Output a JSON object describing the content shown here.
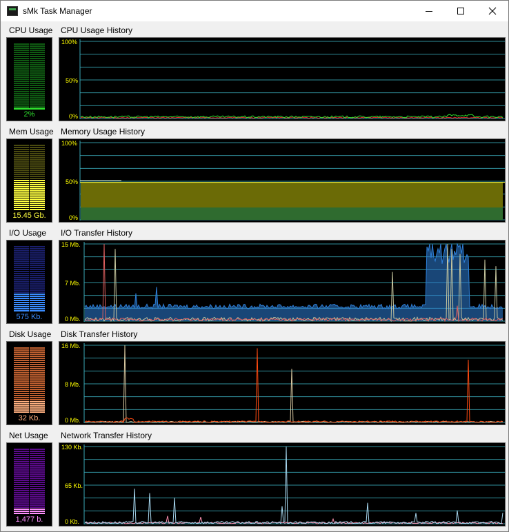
{
  "window": {
    "title": "sMk Task Manager",
    "icon": "app-icon",
    "controls": {
      "minimize": "minimize-icon",
      "maximize": "maximize-icon",
      "close": "close-icon"
    }
  },
  "cpu": {
    "meter_label": "CPU Usage",
    "graph_label": "CPU Usage History",
    "value": "2%",
    "level": 0.02,
    "y_ticks": [
      "100%",
      "50%",
      "0%"
    ],
    "colors": {
      "meter_on": "#2ee02e",
      "meter_off": "#0f5a12",
      "value_text": "#2ee02e",
      "line_1": "#2ee02e",
      "line_2": "#e03030"
    }
  },
  "memory": {
    "meter_label": "Mem Usage",
    "graph_label": "Memory Usage History",
    "value": "15.45 Gb.",
    "level": 0.48,
    "y_ticks": [
      "100%",
      "50%",
      "0%"
    ],
    "colors": {
      "meter_on": "#ffff40",
      "meter_off": "#4a4a10",
      "value_text": "#ffff40",
      "fill_1": "#6b6b06",
      "fill_2": "#2f6b2f"
    }
  },
  "io": {
    "meter_label": "I/O Usage",
    "graph_label": "I/O Transfer History",
    "value": "575 Kb.",
    "level": 0.28,
    "y_ticks": [
      "15 Mb.",
      "7 Mb.",
      "0 Mb."
    ],
    "colors": {
      "meter_on": "#3a8cff",
      "meter_off": "#1a1f6b",
      "value_text": "#3a8cff",
      "line_1": "#2e7fd8",
      "line_2": "#e06060",
      "line_3": "#c8c8a0"
    }
  },
  "disk": {
    "meter_label": "Disk Usage",
    "graph_label": "Disk Transfer History",
    "value": "32 Kb.",
    "level": 0.18,
    "y_ticks": [
      "16 Mb.",
      "8 Mb.",
      "0 Mb."
    ],
    "colors": {
      "meter_on": "#ffb080",
      "meter_off": "#c06030",
      "value_text": "#ffb080",
      "line_1": "#ff4a10",
      "line_2": "#d8c8a0"
    }
  },
  "network": {
    "meter_label": "Net Usage",
    "graph_label": "Network Transfer History",
    "value": "1,477 b.",
    "level": 0.08,
    "y_ticks": [
      "130 Kb.",
      "65 Kb.",
      "0 Kb."
    ],
    "colors": {
      "meter_on": "#ff90ff",
      "meter_off": "#5a0a8a",
      "value_text": "#ff90ff",
      "line_1": "#a8d8f0",
      "line_2": "#ff90b0"
    }
  },
  "grid_color": "#3aa8b8"
}
